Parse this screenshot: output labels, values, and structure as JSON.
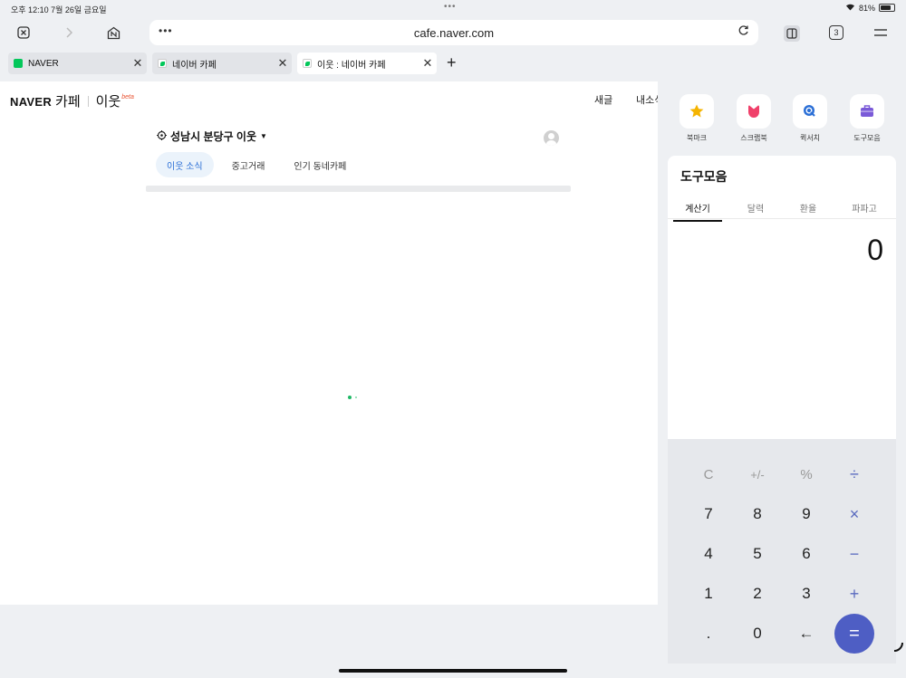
{
  "status_bar": {
    "time": "오후 12:10  7월 26일 금요일",
    "dots": "•••",
    "battery_percent": "81%",
    "battery_level": 0.81
  },
  "toolbar": {
    "url": "cafe.naver.com",
    "more": "•••",
    "tab_count": "3"
  },
  "tabs": [
    {
      "title": "NAVER",
      "favicon_color": "#03c75a"
    },
    {
      "title": "네이버 카페",
      "favicon_color": "#03c75a"
    },
    {
      "title": "이웃 : 네이버 카페",
      "favicon_color": "#03c75a"
    }
  ],
  "page": {
    "logo": {
      "naver": "NAVER",
      "cafe": "카페",
      "iut": "이웃",
      "beta": "beta"
    },
    "nav": {
      "new_post": "새글",
      "my_news": "내소식"
    },
    "region": "성남시 분당구 이웃",
    "subtabs": [
      "이웃 소식",
      "중고거래",
      "인기 동네카페"
    ]
  },
  "panel": {
    "shortcuts": [
      {
        "label": "북마크",
        "icon": "star-icon",
        "color": "#f5b400"
      },
      {
        "label": "스크랩북",
        "icon": "scrap-icon",
        "color": "#f0406a"
      },
      {
        "label": "퀵서치",
        "icon": "quick-search-icon",
        "color": "#2b6fd6"
      },
      {
        "label": "도구모음",
        "icon": "toolbox-icon",
        "color": "#7a5ad8"
      }
    ],
    "tool_title": "도구모음",
    "tool_tabs": [
      "계산기",
      "달력",
      "환율",
      "파파고"
    ],
    "display_value": "0",
    "keys": [
      [
        "C",
        "+/-",
        "%",
        "÷"
      ],
      [
        "7",
        "8",
        "9",
        "×"
      ],
      [
        "4",
        "5",
        "6",
        "−"
      ],
      [
        "1",
        "2",
        "3",
        "+"
      ],
      [
        ".",
        "0",
        "←",
        "="
      ]
    ]
  }
}
